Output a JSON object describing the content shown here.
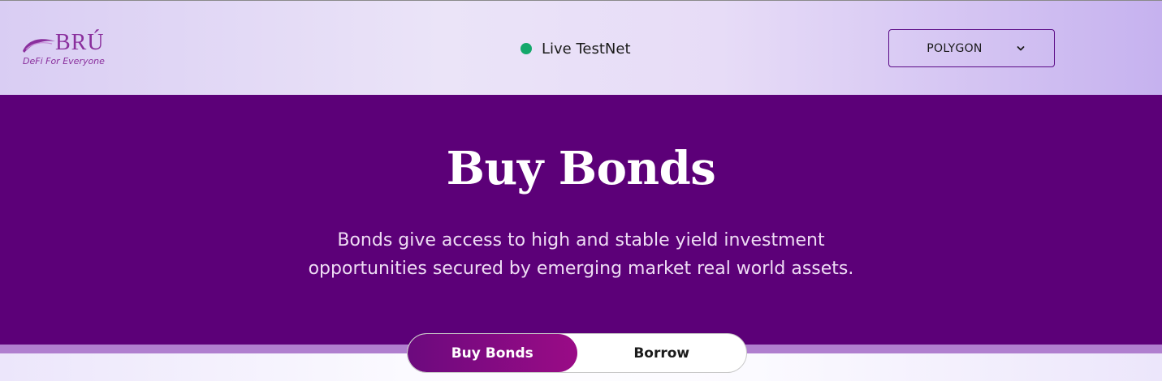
{
  "header": {
    "logo": {
      "wordmark": "BRÚ",
      "tagline": "DeFi For Everyone"
    },
    "status": {
      "label": "Live TestNet",
      "color": "#14a86b"
    },
    "network_select": {
      "selected": "POLYGON",
      "icon": "chevron-down-icon"
    }
  },
  "hero": {
    "title": "Buy Bonds",
    "description_line1": "Bonds give access to high and stable yield investment",
    "description_line2": "opportunities secured by emerging market real world assets."
  },
  "toggle": {
    "active": "Buy Bonds",
    "options": [
      "Buy Bonds",
      "Borrow"
    ]
  },
  "colors": {
    "hero_bg": "#5c0078",
    "accent": "#8a2f9d",
    "toggle_active": "#9a0b86"
  }
}
